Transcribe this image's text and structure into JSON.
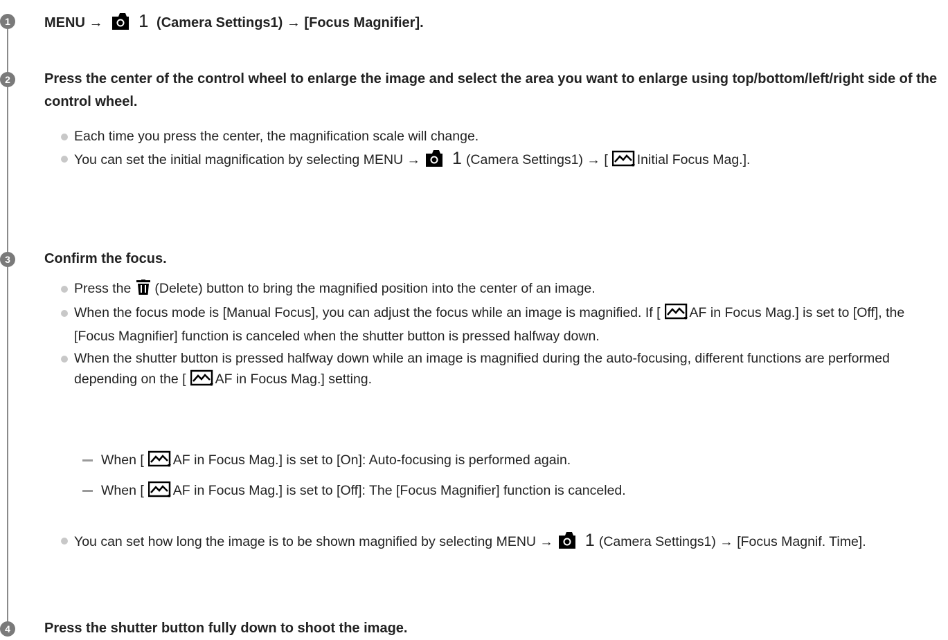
{
  "steps": [
    {
      "number": "1",
      "title_prefix": "MENU →",
      "title_cam_num": "1",
      "title_suffix": "(Camera Settings1) → [Focus Magnifier]."
    },
    {
      "number": "2",
      "title": "Press the center of the control wheel to enlarge the image and select the area you want to enlarge using top/bottom/left/right side of the control wheel.",
      "bullets": [
        {
          "text": "Each time you press the center, the magnification scale will change."
        },
        {
          "pre": "You can set the initial magnification by selecting MENU →",
          "cam_num": "1",
          "mid": "(Camera Settings1) → [",
          "post": "Initial Focus Mag.]."
        }
      ]
    },
    {
      "number": "3",
      "title": "Confirm the focus.",
      "bullets": [
        {
          "pre": "Press the",
          "post": "(Delete) button to bring the magnified position into the center of an image."
        },
        {
          "pre": "When the focus mode is [Manual Focus], you can adjust the focus while an image is magnified. If [",
          "post": "AF in Focus Mag.] is set to [Off], the [Focus Magnifier] function is canceled when the shutter button is pressed halfway down."
        },
        {
          "pre": "When the shutter button is pressed halfway down while an image is magnified during the auto-focusing, different functions are performed depending on the [",
          "post": "AF in Focus Mag.] setting."
        }
      ],
      "sub_items": [
        {
          "pre": "When [",
          "post": "AF in Focus Mag.] is set to [On]: Auto-focusing is performed again."
        },
        {
          "pre": "When [",
          "post": "AF in Focus Mag.] is set to [Off]: The [Focus Magnifier] function is canceled."
        }
      ],
      "last_bullet": {
        "pre": "You can set how long the image is to be shown magnified by selecting MENU →",
        "cam_num": "1",
        "post": "(Camera Settings1) → [Focus Magnif. Time]."
      }
    },
    {
      "number": "4",
      "title": "Press the shutter button fully down to shoot the image."
    }
  ],
  "icons": {
    "camera": "camera-icon",
    "manual_focus": "manual-focus-icon",
    "trash": "trash-icon"
  },
  "colors": {
    "step_badge": "#7a7a7a",
    "timeline": "#8a8a8a",
    "bullet_dot": "#c8c8c8",
    "text": "#222222"
  }
}
